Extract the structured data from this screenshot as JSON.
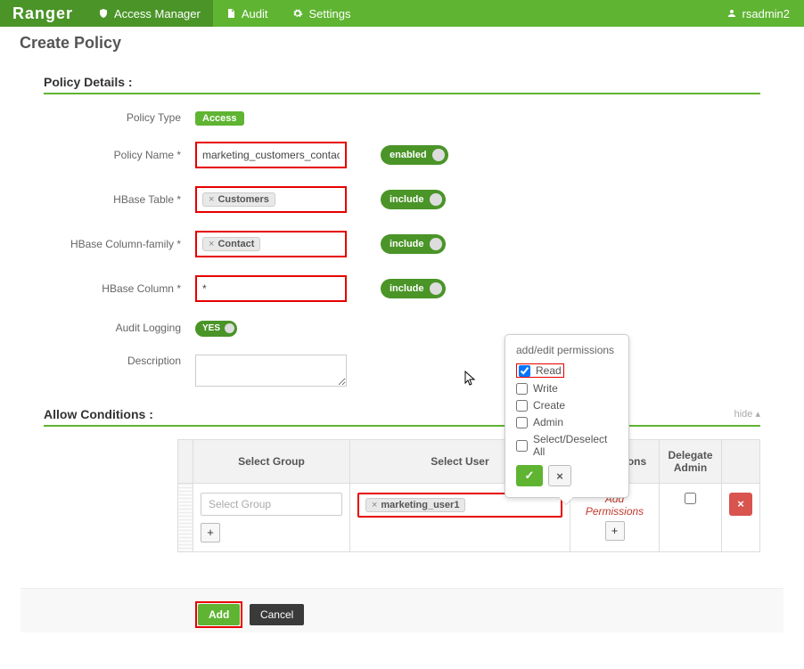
{
  "brand": "Ranger",
  "nav": {
    "access_manager": "Access Manager",
    "audit": "Audit",
    "settings": "Settings",
    "user": "rsadmin2"
  },
  "page_title": "Create Policy",
  "sections": {
    "policy_details": "Policy Details :",
    "allow_conditions": "Allow Conditions :"
  },
  "labels": {
    "policy_type": "Policy Type",
    "policy_name": "Policy Name *",
    "hbase_table": "HBase Table *",
    "hbase_cf": "HBase Column-family *",
    "hbase_col": "HBase Column *",
    "audit_logging": "Audit Logging",
    "description": "Description"
  },
  "values": {
    "policy_type_badge": "Access",
    "policy_name": "marketing_customers_contact",
    "hbase_table_tag": "Customers",
    "hbase_cf_tag": "Contact",
    "hbase_col": "*",
    "description": ""
  },
  "toggles": {
    "enabled": "enabled",
    "include1": "include",
    "include2": "include",
    "include3": "include",
    "yes": "YES"
  },
  "cond_table": {
    "headers": {
      "select_group": "Select Group",
      "select_user": "Select User",
      "permissions": "Permissions",
      "delegate_admin": "Delegate Admin"
    },
    "row": {
      "select_group_placeholder": "Select Group",
      "user_tag": "marketing_user1",
      "add_permissions": "Add Permissions"
    }
  },
  "popover": {
    "title": "add/edit permissions",
    "perms": {
      "read": "Read",
      "write": "Write",
      "create": "Create",
      "admin": "Admin",
      "select_all": "Select/Deselect All"
    }
  },
  "hide_link": "hide  ▴",
  "buttons": {
    "add": "Add",
    "cancel": "Cancel"
  },
  "glyphs": {
    "tag_x": "×",
    "plus": "+",
    "check": "✓",
    "x": "×",
    "del": "×"
  }
}
